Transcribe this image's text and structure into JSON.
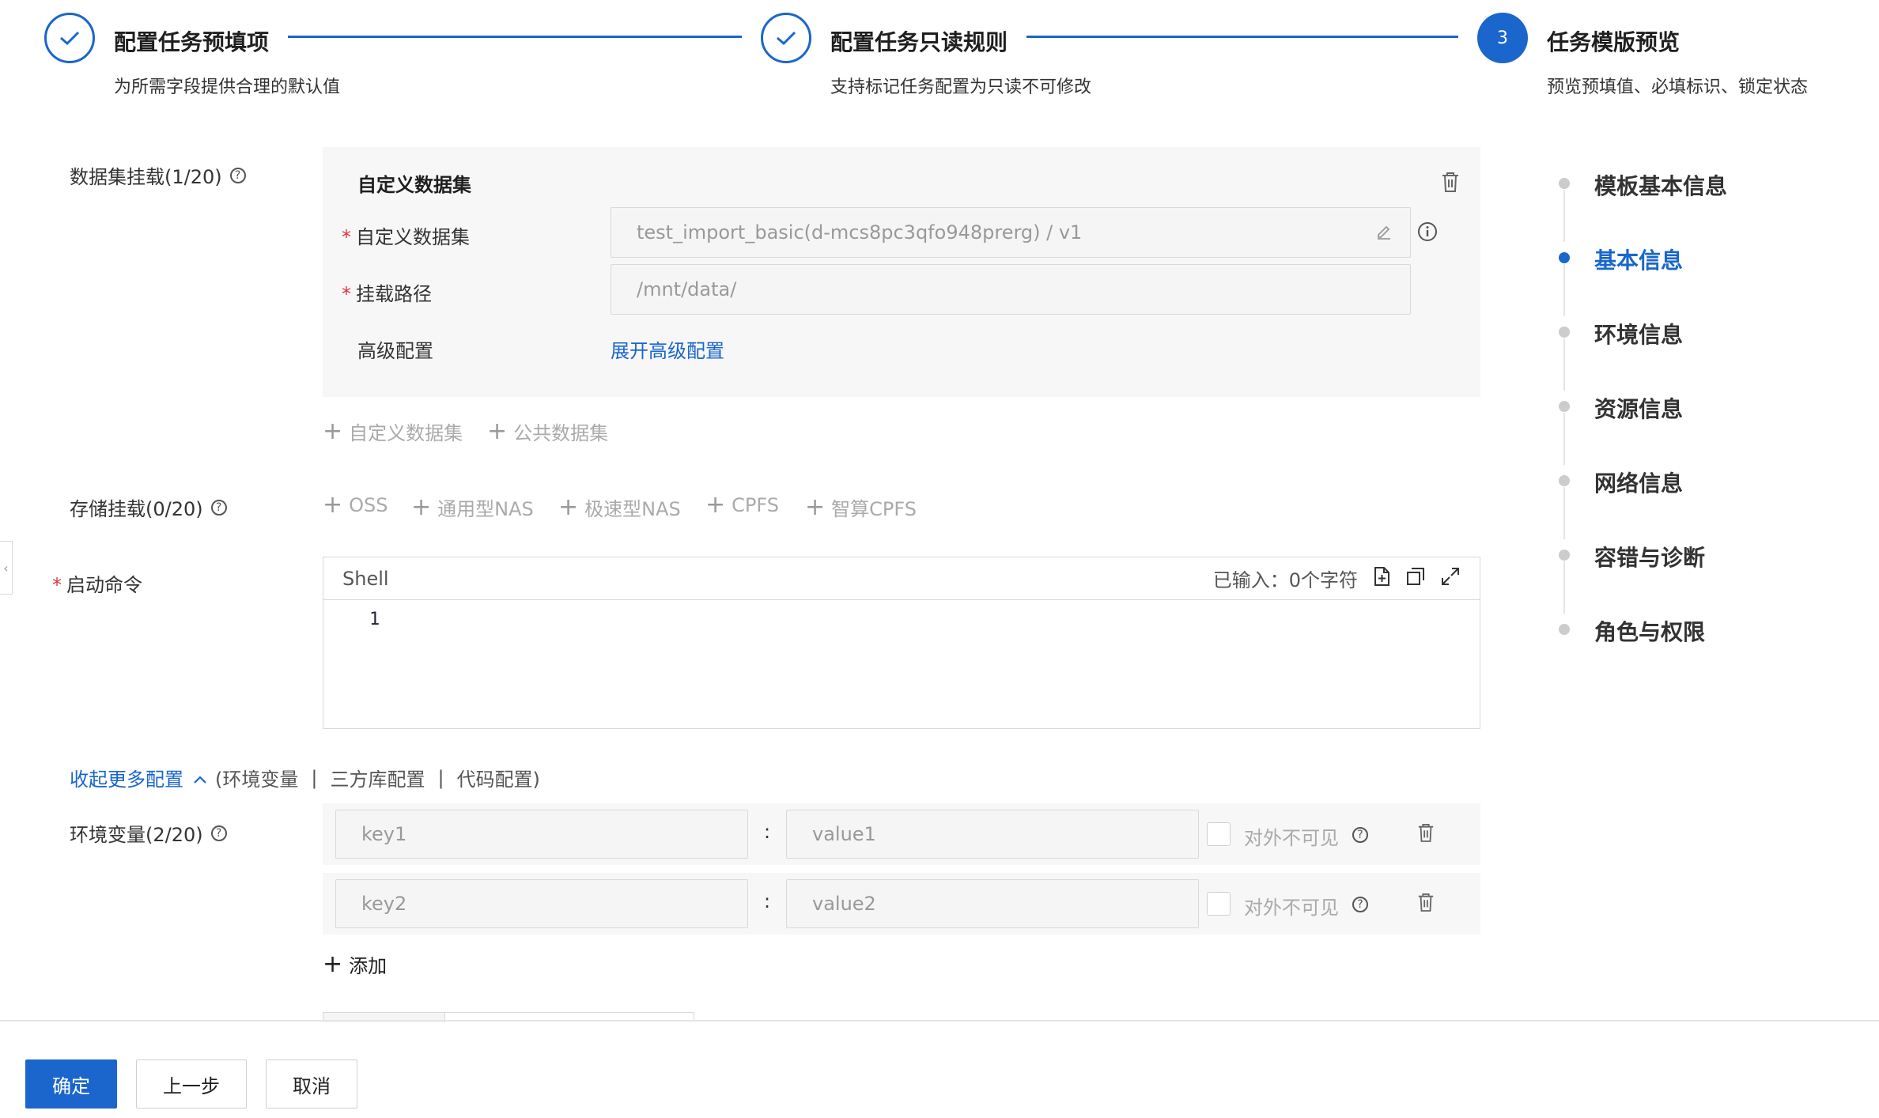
{
  "steps": [
    {
      "title": "配置任务预填项",
      "desc": "为所需字段提供合理的默认值",
      "state": "done"
    },
    {
      "title": "配置任务只读规则",
      "desc": "支持标记任务配置为只读不可修改",
      "state": "done"
    },
    {
      "title": "任务模版预览",
      "desc": "预览预填值、必填标识、锁定状态",
      "state": "active",
      "number": "3"
    }
  ],
  "dataset": {
    "label": "数据集挂载(1/20)",
    "panel_title": "自定义数据集",
    "custom_dataset_label": "自定义数据集",
    "custom_dataset_value": "test_import_basic(d-mcs8pc3qfo948prerg) / v1",
    "mount_path_label": "挂载路径",
    "mount_path_value": "/mnt/data/",
    "advanced_label": "高级配置",
    "advanced_link": "展开高级配置",
    "add_custom": "自定义数据集",
    "add_public": "公共数据集"
  },
  "storage": {
    "label": "存储挂载(0/20)",
    "options": [
      "OSS",
      "通用型NAS",
      "极速型NAS",
      "CPFS",
      "智算CPFS"
    ]
  },
  "command": {
    "label": "启动命令",
    "lang": "Shell",
    "char_count": "已输入：0个字符",
    "line_number": "1"
  },
  "more_config": {
    "toggle": "收起更多配置",
    "hint_open": "(环境变量",
    "hint_mid": "三方库配置",
    "hint_close": "代码配置)",
    "sep": "|"
  },
  "env": {
    "label": "环境变量(2/20)",
    "rows": [
      {
        "key": "key1",
        "value": "value1",
        "invisible_label": "对外不可见"
      },
      {
        "key": "key2",
        "value": "value2",
        "invisible_label": "对外不可见"
      }
    ],
    "colon": ":",
    "add_label": "添加"
  },
  "nav": {
    "items": [
      "模板基本信息",
      "基本信息",
      "环境信息",
      "资源信息",
      "网络信息",
      "容错与诊断",
      "角色与权限"
    ],
    "active_index": 1
  },
  "footer": {
    "confirm": "确定",
    "prev": "上一步",
    "cancel": "取消"
  },
  "colors": {
    "primary": "#1a66cc",
    "required": "#d9363e"
  }
}
